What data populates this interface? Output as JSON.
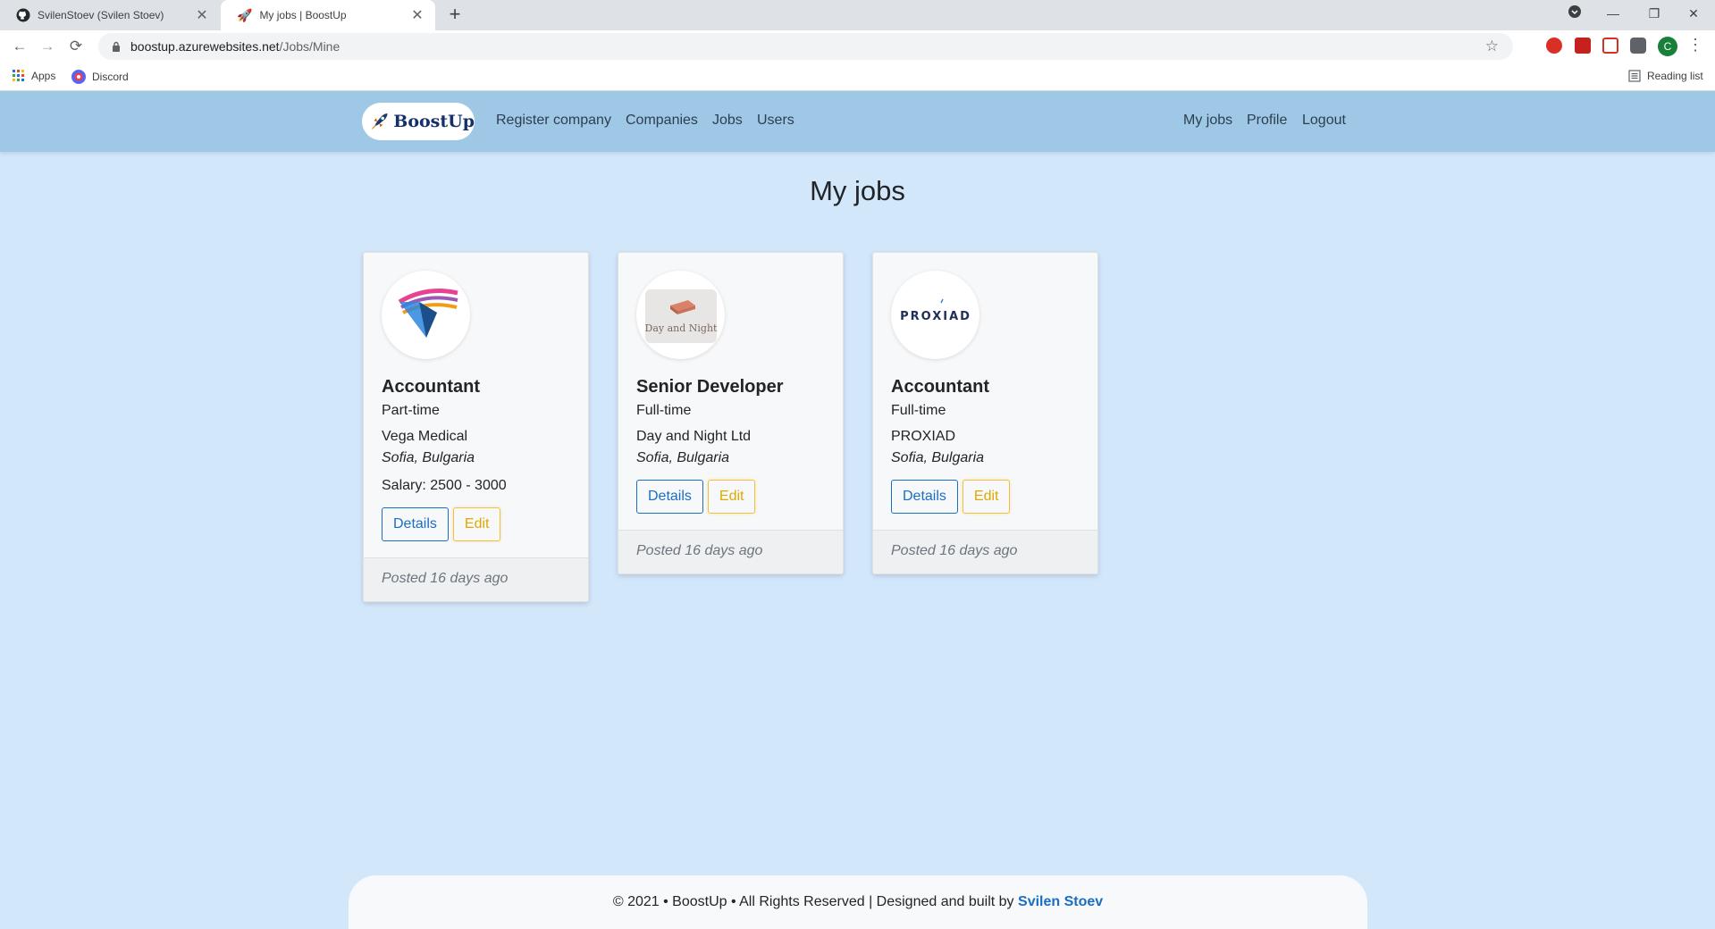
{
  "browser": {
    "tabs": [
      {
        "title": "SvilenStoev (Svilen Stoev)",
        "icon": "github-icon"
      },
      {
        "title": "My jobs | BoostUp",
        "icon": "rocket-icon"
      }
    ],
    "url_host": "boostup.azurewebsites.net",
    "url_path": "/Jobs/Mine",
    "profile_initial": "C",
    "bookmarks": [
      {
        "label": "Apps",
        "icon": "apps-grid-icon"
      },
      {
        "label": "Discord",
        "icon": "discord-icon"
      }
    ],
    "reading_list": "Reading list"
  },
  "site": {
    "brand": "BoostUp",
    "nav_left": [
      "Register company",
      "Companies",
      "Jobs",
      "Users"
    ],
    "nav_right": [
      "My jobs",
      "Profile",
      "Logout"
    ]
  },
  "page": {
    "title": "My jobs"
  },
  "jobs": [
    {
      "title": "Accountant",
      "type": "Part-time",
      "company": "Vega Medical",
      "location": "Sofia, Bulgaria",
      "salary": "Salary: 2500 - 3000",
      "details_label": "Details",
      "edit_label": "Edit",
      "posted": "Posted 16 days ago",
      "logo": "vega-medical-logo"
    },
    {
      "title": "Senior Developer",
      "type": "Full-time",
      "company": "Day and Night Ltd",
      "location": "Sofia, Bulgaria",
      "details_label": "Details",
      "edit_label": "Edit",
      "posted": "Posted 16 days ago",
      "logo": "day-and-night-logo",
      "logo_text": "Day and Night"
    },
    {
      "title": "Accountant",
      "type": "Full-time",
      "company": "PROXIAD",
      "location": "Sofia, Bulgaria",
      "details_label": "Details",
      "edit_label": "Edit",
      "posted": "Posted 16 days ago",
      "logo": "proxiad-logo",
      "logo_text": "PROXIAD"
    }
  ],
  "footer": {
    "text": "© 2021 • BoostUp • All Rights Reserved | Designed and built by",
    "author": "Svilen Stoev"
  },
  "colors": {
    "page_bg": "#d3e7fb",
    "navbar_bg": "#9fc8e6",
    "primary": "#1b6ec2",
    "warning": "#f0c040"
  }
}
